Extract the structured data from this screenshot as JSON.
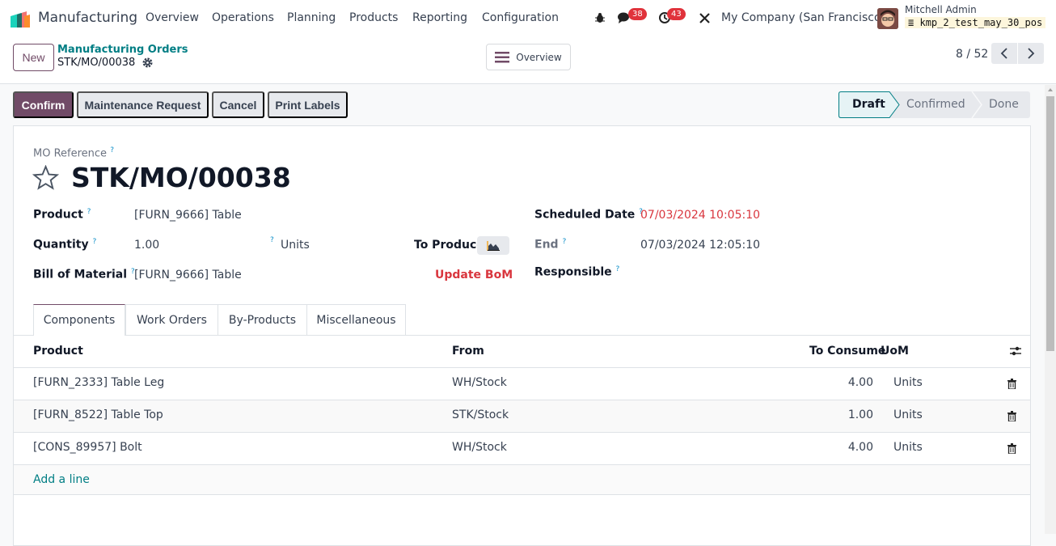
{
  "navbar": {
    "app_name": "Manufacturing",
    "menu": [
      "Overview",
      "Operations",
      "Planning",
      "Products",
      "Reporting",
      "Configuration"
    ],
    "messages_count": "38",
    "activities_count": "43",
    "company": "My Company (San Francisco)",
    "user_name": "Mitchell Admin",
    "database": "kmp_2_test_may_30_pos"
  },
  "control_panel": {
    "new_label": "New",
    "breadcrumb_parent": "Manufacturing Orders",
    "breadcrumb_current": "STK/MO/00038",
    "overview_label": "Overview",
    "pager": "8 / 52"
  },
  "actions": [
    "Confirm",
    "Maintenance Request",
    "Cancel",
    "Print Labels"
  ],
  "statusbar": {
    "stages": [
      "Draft",
      "Confirmed",
      "Done"
    ],
    "current": "Draft"
  },
  "form": {
    "reference_label": "MO Reference",
    "reference": "STK/MO/00038",
    "product_label": "Product",
    "product": "[FURN_9666] Table",
    "quantity_label": "Quantity",
    "quantity": "1.00",
    "uom": "Units",
    "to_produce_label": "To Produce",
    "bom_label": "Bill of Material",
    "bom": "[FURN_9666] Table",
    "update_bom": "Update BoM",
    "scheduled_label": "Scheduled Date",
    "scheduled": "07/03/2024 10:05:10",
    "end_label": "End",
    "end": "07/03/2024 12:05:10",
    "responsible_label": "Responsible",
    "help": "?"
  },
  "tabs": [
    "Components",
    "Work Orders",
    "By-Products",
    "Miscellaneous"
  ],
  "table": {
    "headers": {
      "product": "Product",
      "from": "From",
      "to_consume": "To Consume",
      "uom": "UoM"
    },
    "rows": [
      {
        "product": "[FURN_2333] Table Leg",
        "from": "WH/Stock",
        "to_consume": "4.00",
        "uom": "Units"
      },
      {
        "product": "[FURN_8522] Table Top",
        "from": "STK/Stock",
        "to_consume": "1.00",
        "uom": "Units"
      },
      {
        "product": "[CONS_89957] Bolt",
        "from": "WH/Stock",
        "to_consume": "4.00",
        "uom": "Units"
      }
    ],
    "add_line": "Add a line"
  },
  "colors": {
    "primary": "#714b67",
    "link": "#017e84",
    "danger": "#d9363e"
  }
}
